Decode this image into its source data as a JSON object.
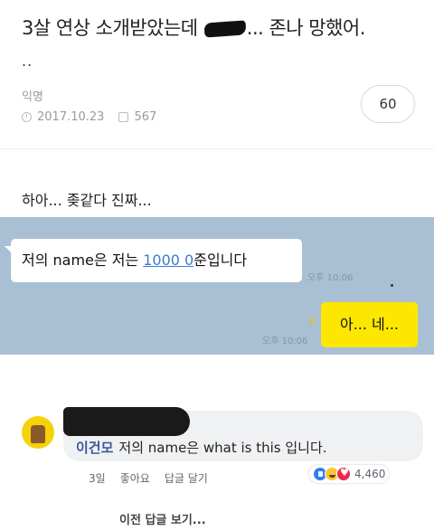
{
  "post": {
    "title_before": "3살 연상 소개받았는데 ",
    "title_after": "... 존나 망했어.",
    "title_cont": "..",
    "author": "익명",
    "date": "2017.10.23",
    "views": "567",
    "comment_count": "60",
    "body": "하아... 좆같다 진짜..."
  },
  "chat": {
    "msg_prefix": "저의 name은 저는 ",
    "msg_number": "1000 0",
    "msg_suffix": "준입니다",
    "time_left": "오후 10:06",
    "read_count": "1",
    "time_right": "오후 10:06",
    "reply": "아... 네...",
    "colors": {
      "background": "#a9bfd4",
      "my_bubble": "#fde600"
    }
  },
  "comment": {
    "author": "이건모",
    "text": "저의 name은 what is this 입니다.",
    "time": "3일",
    "like_label": "좋아요",
    "reply_label": "답글 달기",
    "reaction_count": "4,460",
    "reaction_icons": [
      "like-icon",
      "haha-icon",
      "love-icon"
    ],
    "view_previous": "이전 답글 보기..."
  }
}
